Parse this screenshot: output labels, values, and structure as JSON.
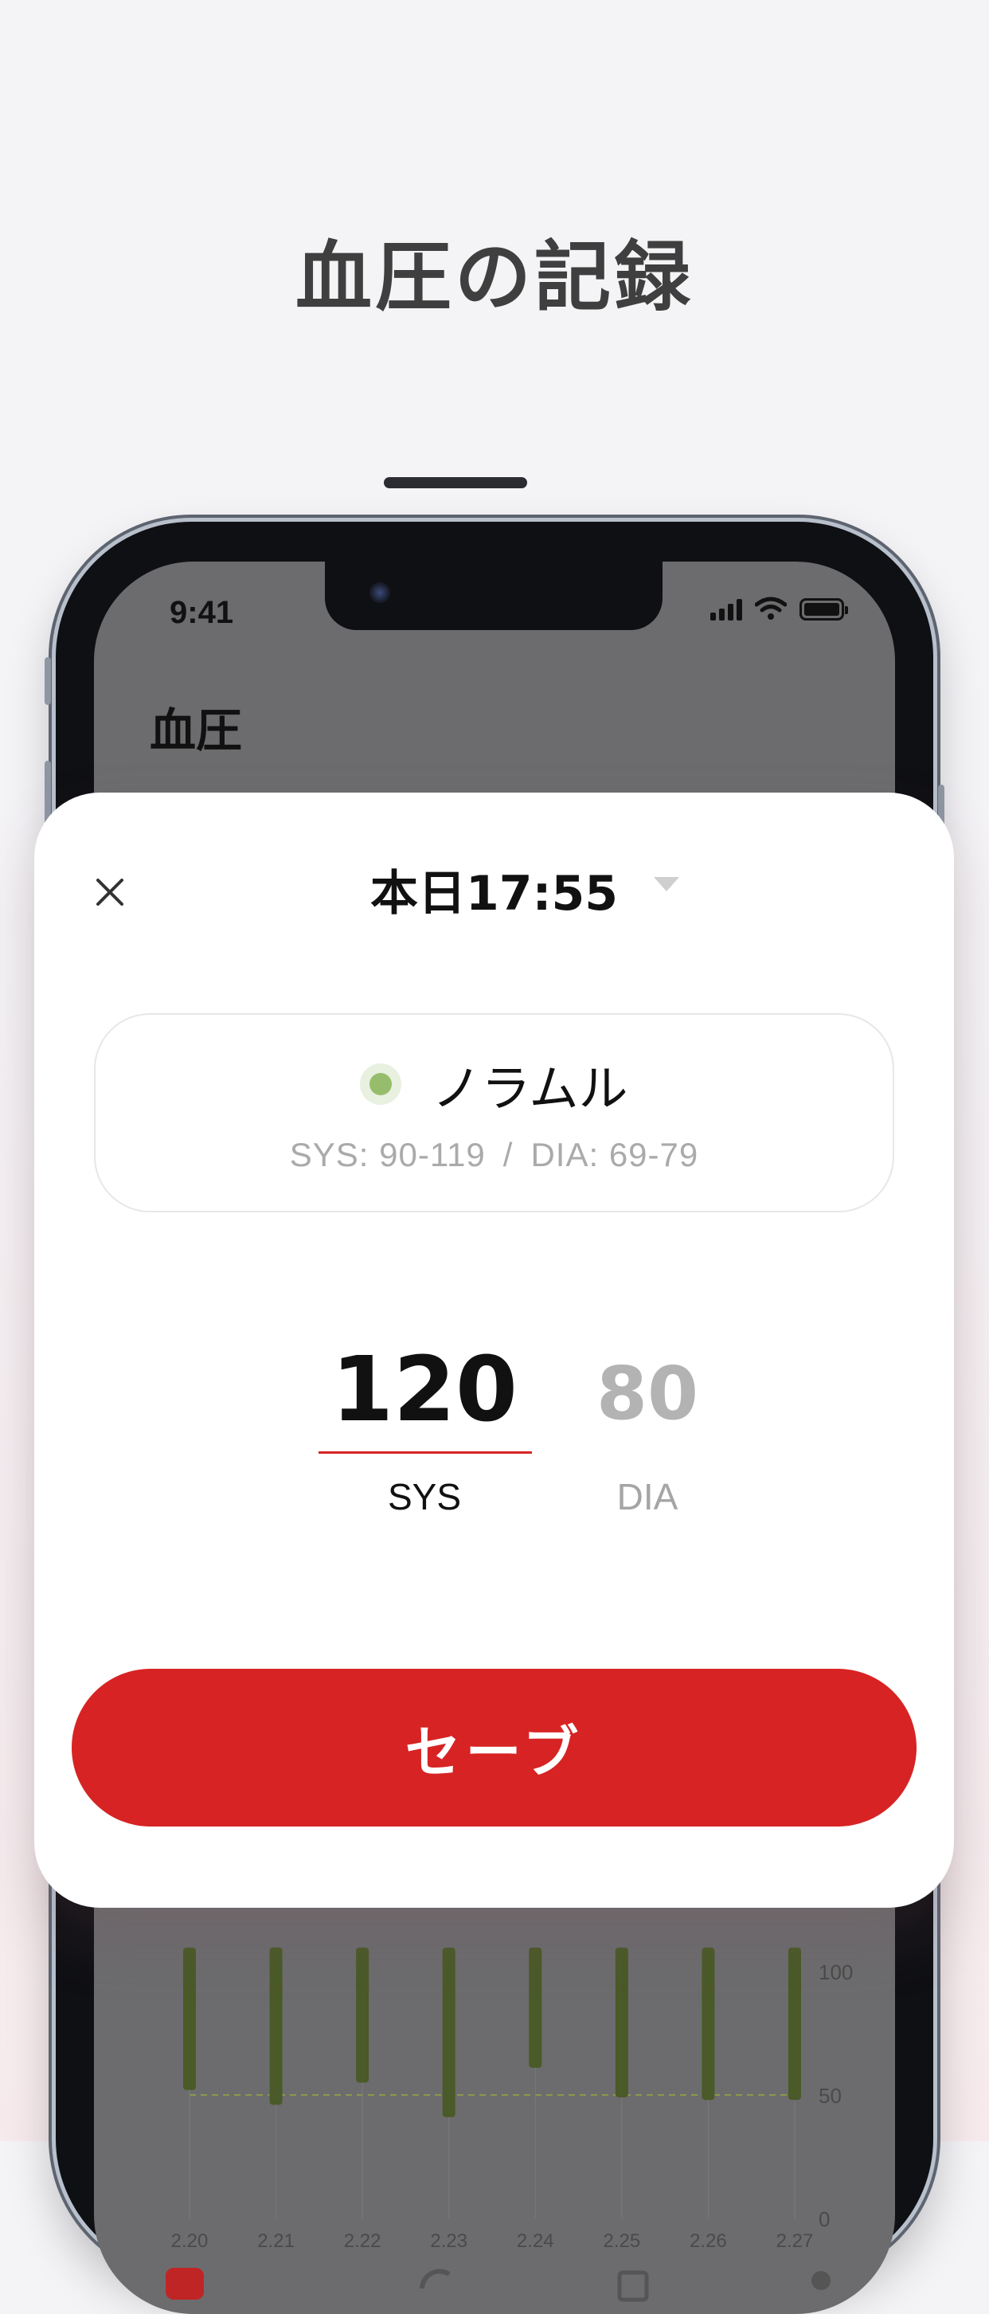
{
  "headline": "血圧の記録",
  "status_bar": {
    "time": "9:41"
  },
  "app": {
    "title": "血圧"
  },
  "sheet": {
    "date": "本日17:55",
    "category": {
      "label": "ノラムル",
      "dot_color": "#96bd6b",
      "sys_range": "SYS: 90-119",
      "separator": "/",
      "dia_range": "DIA: 69-79"
    },
    "readings": {
      "sys_value": "120",
      "sys_label": "SYS",
      "dia_value": "80",
      "dia_label": "DIA"
    },
    "save_label": "セーブ",
    "accent_color": "#d72323"
  },
  "chart_data": {
    "type": "bar",
    "categories": [
      "2.20",
      "2.21",
      "2.22",
      "2.23",
      "2.24",
      "2.25",
      "2.26",
      "2.27"
    ],
    "low_values": [
      52,
      46,
      55,
      41,
      61,
      49,
      48,
      48
    ],
    "y_ticks": [
      "0",
      "50",
      "100"
    ],
    "ylim": [
      0,
      100
    ]
  }
}
